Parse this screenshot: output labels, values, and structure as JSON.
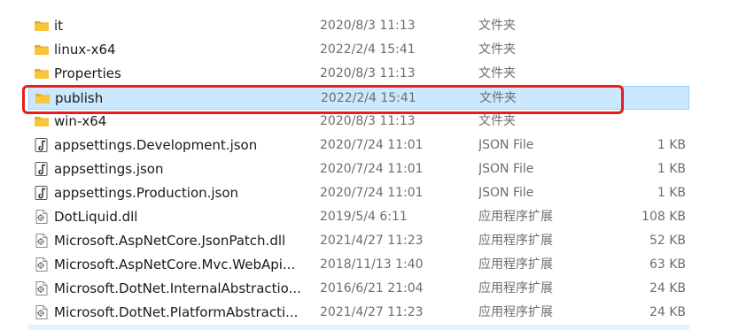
{
  "files": [
    {
      "name": "it",
      "date": "2020/8/3 11:13",
      "type": "文件夹",
      "size": "",
      "icon": "folder-icon"
    },
    {
      "name": "linux-x64",
      "date": "2022/2/4 15:41",
      "type": "文件夹",
      "size": "",
      "icon": "folder-icon"
    },
    {
      "name": "Properties",
      "date": "2020/8/3 11:13",
      "type": "文件夹",
      "size": "",
      "icon": "folder-icon"
    },
    {
      "name": "publish",
      "date": "2022/2/4 15:41",
      "type": "文件夹",
      "size": "",
      "icon": "folder-icon",
      "selected": true
    },
    {
      "name": "win-x64",
      "date": "2020/8/3 11:13",
      "type": "文件夹",
      "size": "",
      "icon": "folder-icon"
    },
    {
      "name": "appsettings.Development.json",
      "date": "2020/7/24 11:01",
      "type": "JSON File",
      "size": "1 KB",
      "icon": "json-file-icon"
    },
    {
      "name": "appsettings.json",
      "date": "2020/7/24 11:01",
      "type": "JSON File",
      "size": "1 KB",
      "icon": "json-file-icon"
    },
    {
      "name": "appsettings.Production.json",
      "date": "2020/7/24 11:01",
      "type": "JSON File",
      "size": "1 KB",
      "icon": "json-file-icon"
    },
    {
      "name": "DotLiquid.dll",
      "date": "2019/5/4 6:11",
      "type": "应用程序扩展",
      "size": "108 KB",
      "icon": "dll-file-icon"
    },
    {
      "name": "Microsoft.AspNetCore.JsonPatch.dll",
      "date": "2021/4/27 11:23",
      "type": "应用程序扩展",
      "size": "52 KB",
      "icon": "dll-file-icon"
    },
    {
      "name": "Microsoft.AspNetCore.Mvc.WebApi...",
      "date": "2018/11/13 1:40",
      "type": "应用程序扩展",
      "size": "63 KB",
      "icon": "dll-file-icon"
    },
    {
      "name": "Microsoft.DotNet.InternalAbstractio...",
      "date": "2016/6/21 21:04",
      "type": "应用程序扩展",
      "size": "24 KB",
      "icon": "dll-file-icon"
    },
    {
      "name": "Microsoft.DotNet.PlatformAbstracti...",
      "date": "2021/4/27 11:23",
      "type": "应用程序扩展",
      "size": "24 KB",
      "icon": "dll-file-icon"
    }
  ],
  "colors": {
    "selection_bg": "#cce8ff",
    "selection_border": "#99d1ff",
    "annotation_red": "#e81c1c",
    "folder_yellow": "#f8c63c"
  }
}
